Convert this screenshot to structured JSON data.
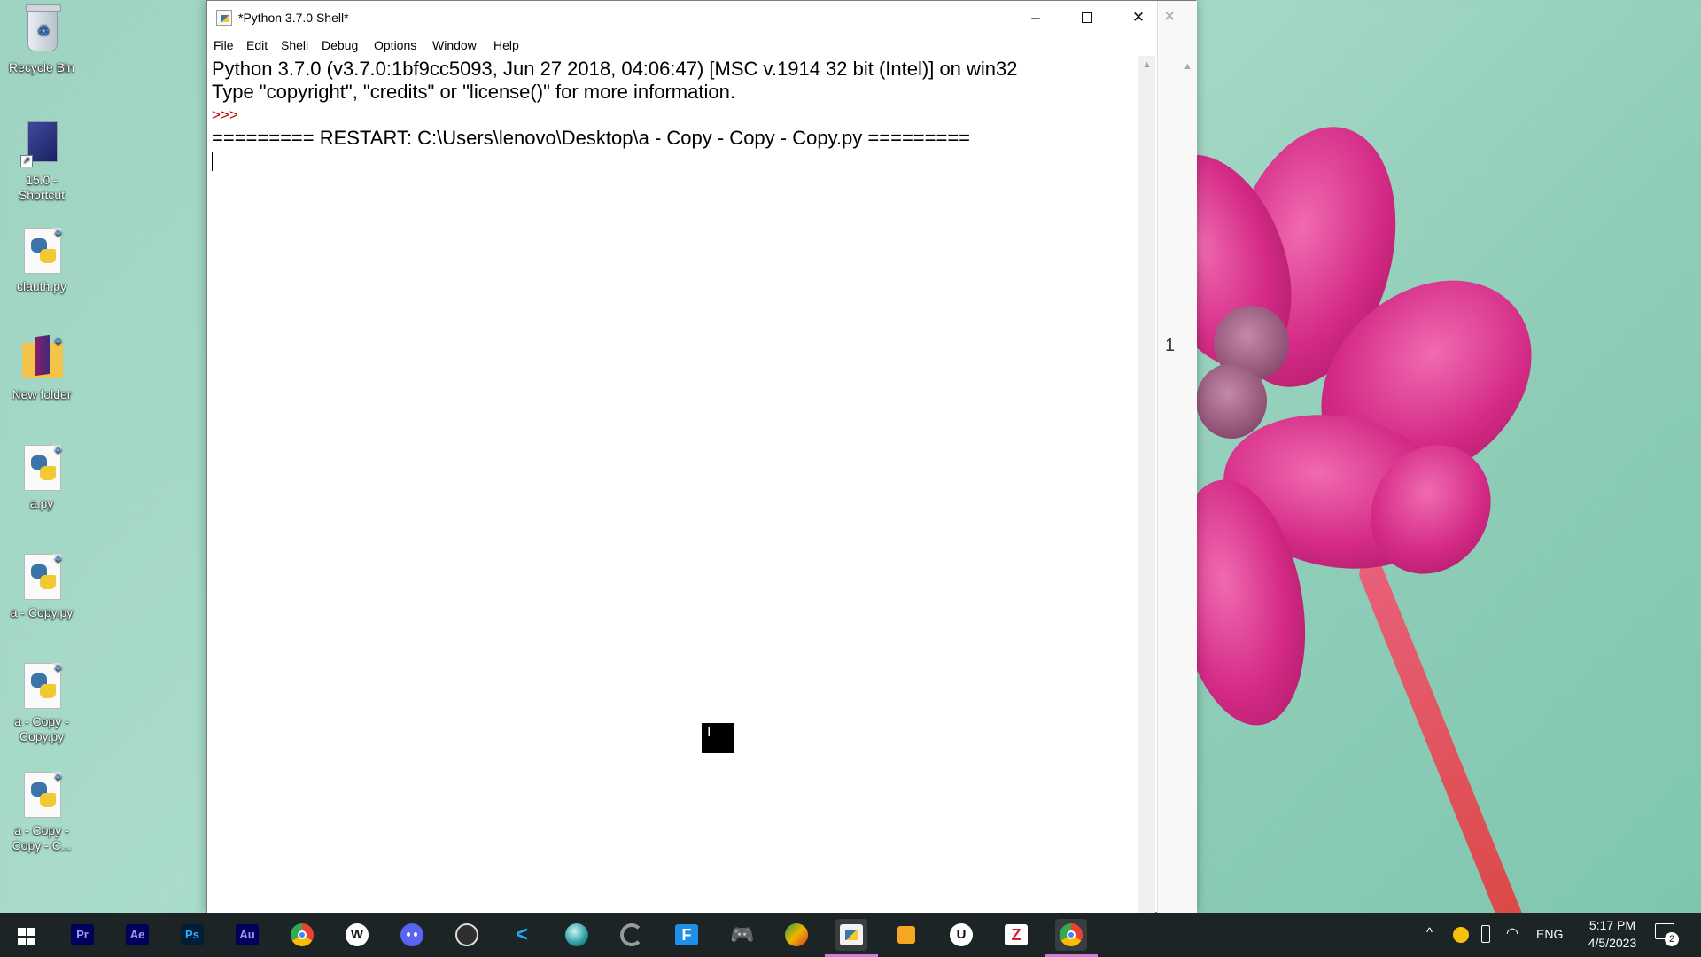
{
  "desktop": {
    "icons": [
      {
        "label": "Recycle Bin"
      },
      {
        "label": "15.0 -\nShortcut"
      },
      {
        "label": "clauth.py"
      },
      {
        "label": "New folder"
      },
      {
        "label": "a.py"
      },
      {
        "label": "a - Copy.py"
      },
      {
        "label": "a - Copy -\nCopy.py"
      },
      {
        "label": "a - Copy -\nCopy - C..."
      }
    ]
  },
  "window": {
    "title": "*Python 3.7.0 Shell*",
    "controls": {
      "minimize": "–",
      "close": "✕"
    },
    "menu": [
      "File",
      "Edit",
      "Shell",
      "Debug",
      "Options",
      "Window",
      "Help"
    ],
    "shell": {
      "line1": "Python 3.7.0 (v3.7.0:1bf9cc5093, Jun 27 2018, 04:06:47) [MSC v.1914 32 bit (Intel)] on win32",
      "line2": "Type \"copyright\", \"credits\" or \"license()\" for more information.",
      "prompt": ">>> ",
      "line3": "========= RESTART: C:\\Users\\lenovo\\Desktop\\a - Copy - Copy - Copy.py ========="
    },
    "background_window": {
      "close": "✕",
      "fragment": "1"
    }
  },
  "taskbar": {
    "apps": [
      {
        "icon": "premiere-pro-icon",
        "text": "Pr",
        "color": "#00005b",
        "fg": "#9999ff"
      },
      {
        "icon": "after-effects-icon",
        "text": "Ae",
        "color": "#00005b",
        "fg": "#9999ff"
      },
      {
        "icon": "photoshop-icon",
        "text": "Ps",
        "color": "#001e36",
        "fg": "#31a8ff"
      },
      {
        "icon": "audition-icon",
        "text": "Au",
        "color": "#00005b",
        "fg": "#9999ff"
      }
    ],
    "tray": {
      "language": "ENG",
      "time": "5:17 PM",
      "date": "4/5/2023",
      "notifications": "2"
    }
  },
  "colors": {
    "prompt": "#c00000",
    "taskbar": "#1d2426",
    "active_indicator": "#d57ad8"
  }
}
